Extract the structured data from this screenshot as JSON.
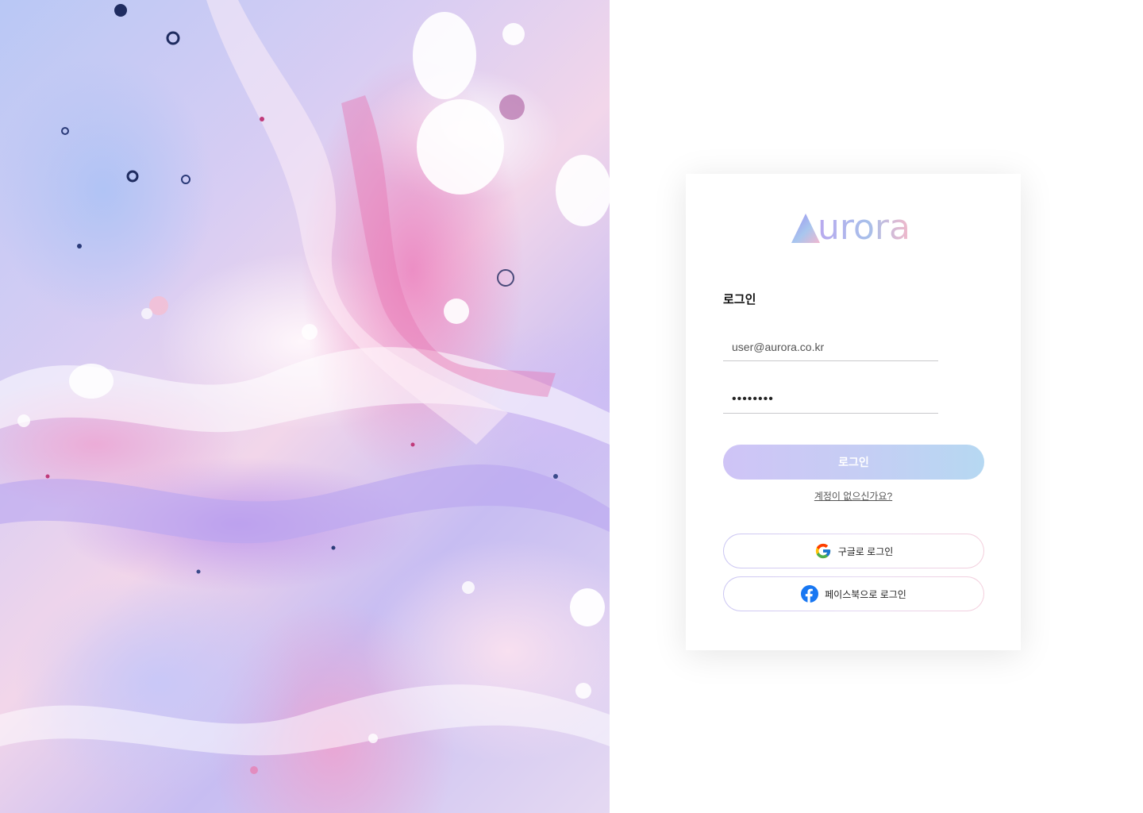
{
  "logo": {
    "text": "urora",
    "mark": "triangle-gradient-icon"
  },
  "login": {
    "title": "로그인",
    "email_placeholder": "user@aurora.co.kr",
    "password_value": "••••••••",
    "submit_label": "로그인",
    "signup_text": "계정이 없으신가요?"
  },
  "social": {
    "google_label": "구글로 로그인",
    "google_icon": "google-icon",
    "facebook_label": "페이스북으로 로그인",
    "facebook_icon": "facebook-icon"
  },
  "colors": {
    "gradient_start": "#cfc4f6",
    "gradient_end": "#b6d8f2",
    "logo_pink": "#f3b8c9",
    "facebook_blue": "#1877f2"
  }
}
